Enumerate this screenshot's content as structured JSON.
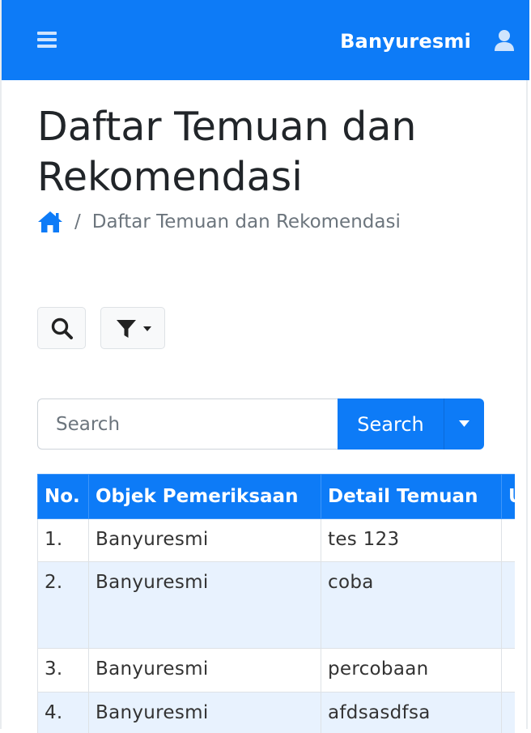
{
  "header": {
    "brand": "Banyuresmi"
  },
  "page": {
    "title": "Daftar Temuan dan Rekomendasi",
    "breadcrumb_current": "Daftar Temuan dan Rekomendasi",
    "breadcrumb_separator": "/"
  },
  "search": {
    "placeholder": "Search",
    "button_label": "Search"
  },
  "table": {
    "columns": [
      "No.",
      "Objek Pemeriksaan",
      "Detail Temuan",
      "U"
    ],
    "rows": [
      {
        "no": "1.",
        "objek": "Banyuresmi",
        "detail": "tes 123"
      },
      {
        "no": "2.",
        "objek": "Banyuresmi",
        "detail": "coba"
      },
      {
        "no": "3.",
        "objek": "Banyuresmi",
        "detail": "percobaan"
      },
      {
        "no": "4.",
        "objek": "Banyuresmi",
        "detail": "afdsasdfsa"
      }
    ]
  },
  "colors": {
    "primary": "#0d7bf7",
    "row_striped": "#e8f2fe"
  },
  "icons": [
    "hamburger-icon",
    "user-icon",
    "home-icon",
    "search-icon",
    "filter-icon",
    "caret-down-icon"
  ]
}
